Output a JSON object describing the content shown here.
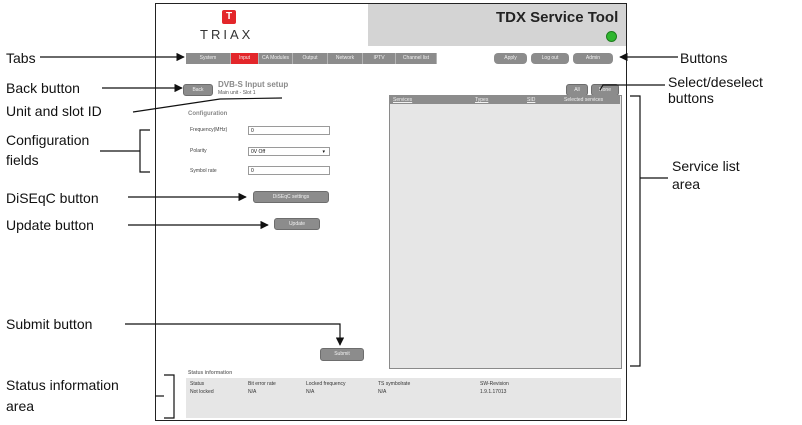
{
  "header": {
    "brand": "TRIAX",
    "app_title": "TDX Service Tool"
  },
  "tabs": [
    "System",
    "Input",
    "CA Modules",
    "Output",
    "Network",
    "IPTV",
    "Channel list"
  ],
  "active_tab": "Input",
  "header_buttons": [
    "Apply",
    "Log out",
    "Admin"
  ],
  "page": {
    "back_label": "Back",
    "title": "DVB-S Input setup",
    "unit_slot": "Main unit - Slot 1",
    "section": "Configuration",
    "fields": [
      {
        "label": "Frequency(MHz)",
        "value": "0"
      },
      {
        "label": "Polarity",
        "value": "0V Off"
      },
      {
        "label": "Symbol rate",
        "value": "0"
      }
    ],
    "diseqc_label": "DiSEqC settings",
    "update_label": "Update",
    "submit_label": "Submit"
  },
  "service_list": {
    "all_label": "All",
    "none_label": "None",
    "columns": [
      "Services",
      "Types",
      "SID",
      "Selected services"
    ]
  },
  "status": {
    "title": "Status information",
    "headers": [
      "Status",
      "Bit error rate",
      "Locked frequency",
      "TS symbolrate",
      "SW-Revision"
    ],
    "values": [
      "Not locked",
      "N/A",
      "N/A",
      "N/A",
      "1.9.1.17013"
    ]
  },
  "callouts": {
    "tabs": "Tabs",
    "back_button": "Back button",
    "unit_slot": "Unit and slot ID",
    "config_line1": "Configuration",
    "config_line2": "fields",
    "diseqc": "DiSEqC button",
    "update": "Update button",
    "submit": "Submit button",
    "status_line1": "Status information",
    "status_line2": "area",
    "buttons": "Buttons",
    "select_line1": "Select/deselect",
    "select_line2": "buttons",
    "service_line1": "Service list",
    "service_line2": "area"
  }
}
